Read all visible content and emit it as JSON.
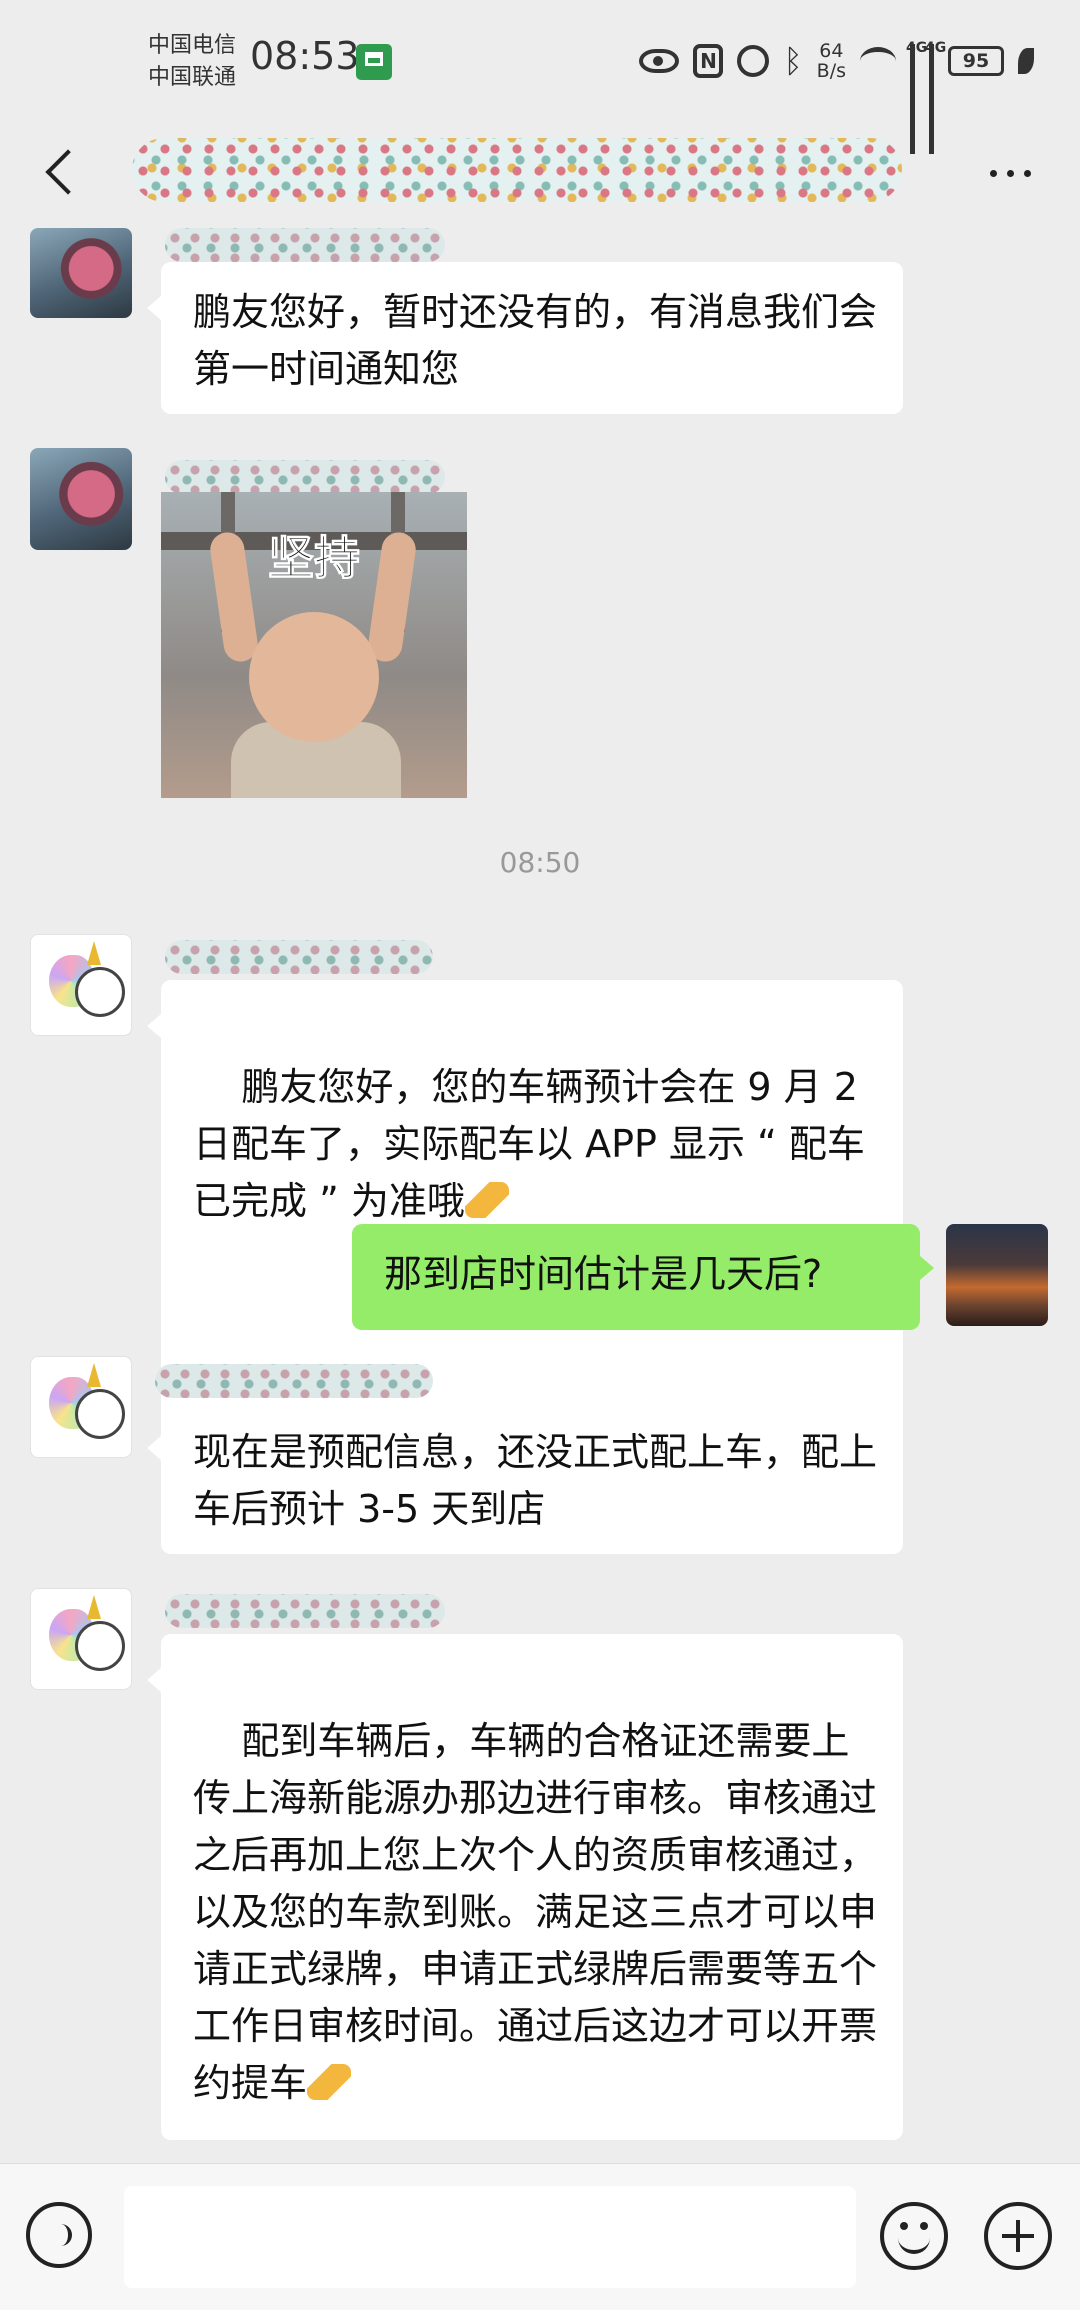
{
  "status_bar": {
    "carrier_1": "中国电信",
    "carrier_2": "中国联通",
    "time": "08:53",
    "net_speed_value": "64",
    "net_speed_unit": "B/s",
    "network_1": "4G",
    "network_2": "4G",
    "battery": "95",
    "icons": [
      "shop-icon",
      "eye-icon",
      "nfc-icon",
      "alarm-icon",
      "bluetooth-icon",
      "wifi-icon",
      "signal-icon",
      "battery-icon",
      "leaf-icon"
    ]
  },
  "nav": {
    "back_icon": "chevron-left-icon",
    "more_icon": "more-dots-icon"
  },
  "chat": {
    "messages": [
      {
        "side": "in",
        "avatar": "bear-avatar",
        "text": "鹏友您好，暂时还没有的，有消息我们会第一时间通知您"
      },
      {
        "side": "in",
        "avatar": "bear-avatar",
        "type": "sticker",
        "sticker_text": "坚持"
      },
      {
        "type": "time",
        "text": "08:50"
      },
      {
        "side": "in",
        "avatar": "unicorn-avatar",
        "text": "鹏友您好，您的车辆预计会在 9 月 2日配车了，实际配车以 APP 显示 “ 配车已完成 ” 为准哦"
      },
      {
        "side": "out",
        "avatar": "self-avatar",
        "text": "那到店时间估计是几天后?"
      },
      {
        "side": "in",
        "avatar": "unicorn-avatar",
        "text": "现在是预配信息，还没正式配上车，配上车后预计 3-5 天到店"
      },
      {
        "side": "in",
        "avatar": "unicorn-avatar",
        "text": "配到车辆后，车辆的合格证还需要上传上海新能源办那边进行审核。审核通过之后再加上您上次个人的资质审核通过，以及您的车款到账。满足这三点才可以申请正式绿牌，申请正式绿牌后需要等五个工作日审核时间。通过后这边才可以开票约提车"
      }
    ]
  },
  "input_bar": {
    "voice_icon": "voice-icon",
    "emoji_icon": "emoji-icon",
    "plus_icon": "plus-icon",
    "text_value": ""
  },
  "colors": {
    "background": "#ededed",
    "incoming_bubble": "#ffffff",
    "outgoing_bubble": "#95ec69"
  }
}
